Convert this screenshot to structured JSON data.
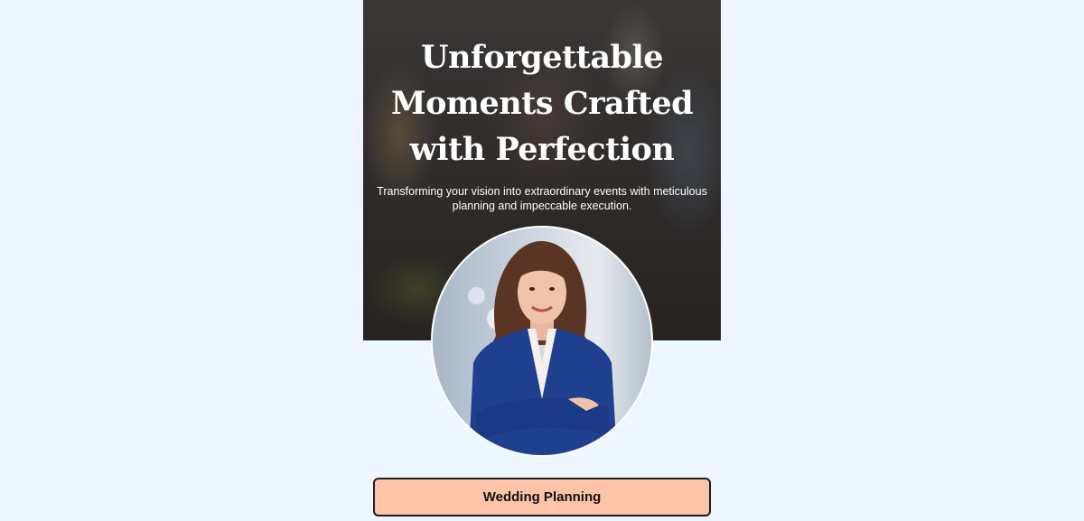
{
  "hero": {
    "title": "Unforgettable Moments Crafted with Perfection",
    "subtitle": "Transforming your vision into extraordinary events with meticulous planning and impeccable execution."
  },
  "service": {
    "label": "Wedding Planning"
  },
  "colors": {
    "page_background": "#eef6ff",
    "button_background": "#fdc4a9",
    "button_border": "#1c1c1c",
    "hero_text": "#ffffff"
  }
}
